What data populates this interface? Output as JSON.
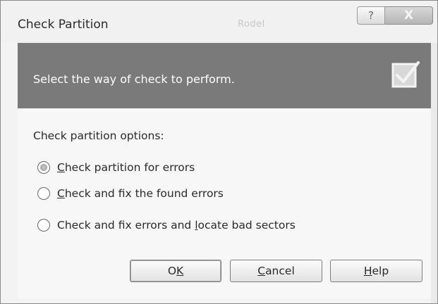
{
  "window": {
    "title": "Check Partition",
    "faded_title": "Rodel",
    "help_glyph": "?",
    "close_glyph": "X"
  },
  "banner": {
    "instruction": "Select the way of check to perform.",
    "icon": "checkbox-check-icon",
    "background": "#7a7a7a"
  },
  "options": {
    "group_label": "Check partition options:",
    "items": [
      {
        "accel": "C",
        "rest": "heck partition for errors",
        "selected": true
      },
      {
        "accel": "C",
        "rest": "heck and fix the found errors",
        "selected": false
      },
      {
        "prefix": "Check and fix errors and ",
        "accel": "l",
        "rest": "ocate bad sectors",
        "selected": false
      }
    ]
  },
  "buttons": {
    "ok": {
      "pre": "O",
      "accel": "K"
    },
    "cancel": {
      "accel": "C",
      "rest": "ancel"
    },
    "help": {
      "accel": "H",
      "rest": "elp"
    }
  }
}
